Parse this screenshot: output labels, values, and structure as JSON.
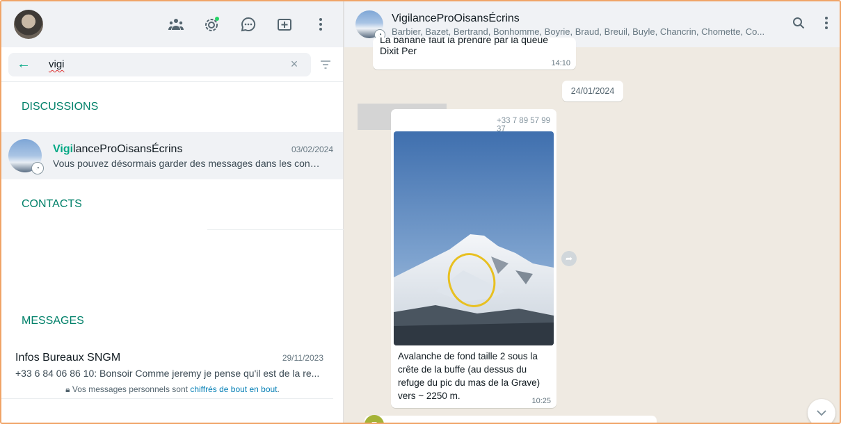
{
  "left": {
    "search": {
      "value": "vigi"
    },
    "sections": {
      "discussions": "DISCUSSIONS",
      "contacts": "CONTACTS",
      "messages": "MESSAGES"
    },
    "discussion": {
      "name_highlight": "Vigi",
      "name_rest": "lanceProOisansÉcrins",
      "date": "03/02/2024",
      "preview": "Vous pouvez désormais garder des messages dans les conv..."
    },
    "message": {
      "name": "Infos Bureaux SNGM",
      "date": "29/11/2023",
      "preview": "+33 6 84 06 86 10: Bonsoir  Comme jeremy je pense qu'il est de la re..."
    },
    "encryption": {
      "prefix": "Vos messages personnels sont ",
      "link": "chiffrés de bout en bout",
      "suffix": "."
    },
    "icons": [
      "community-icon",
      "status-icon",
      "channels-icon",
      "new-chat-icon",
      "menu-icon"
    ]
  },
  "right": {
    "group": {
      "name": "VigilanceProOisansÉcrins",
      "members": "Barbier, Bazet, Bertrand, Bonhomme, Boyrie, Braud, Breuil, Buyle, Chancrin, Chomette, Co..."
    },
    "messages": [
      {
        "text_cut": "La banane faut la prendre par la queue",
        "text": "Dixit Per",
        "time": "14:10"
      },
      {
        "date": "24/01/2024"
      },
      {
        "phone": "+33 7 89 57 99 37",
        "caption": "Avalanche de fond taille 2 sous la crête de la buffe (au dessus du refuge du pic du mas de la Grave) vers ~ 2250 m.",
        "time": "10:25"
      }
    ],
    "next_sender_initial": "E"
  }
}
